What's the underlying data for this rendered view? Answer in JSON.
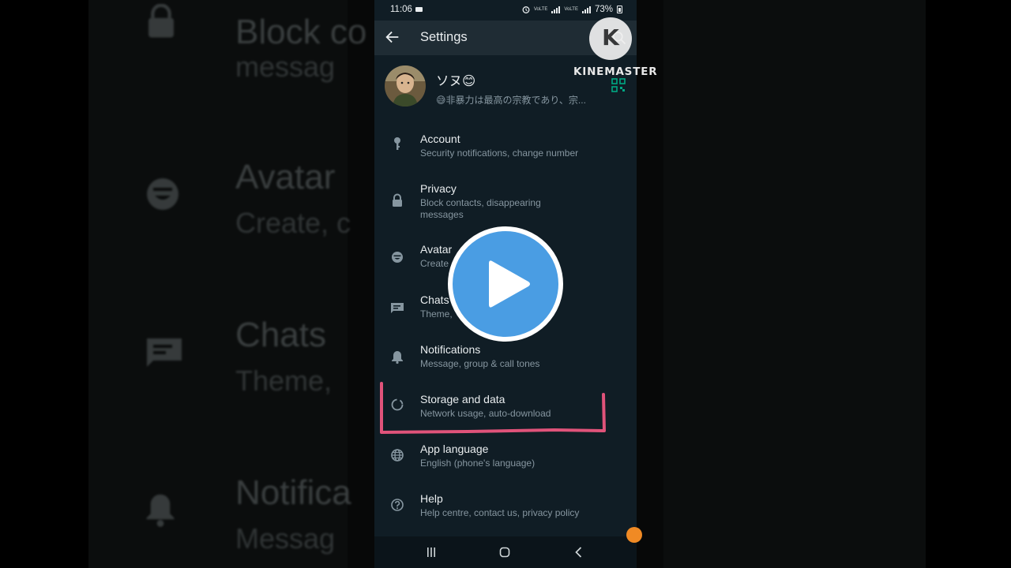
{
  "status_bar": {
    "time": "11:06",
    "battery": "73%",
    "sim_label": "VoLTE"
  },
  "app_bar": {
    "title": "Settings"
  },
  "profile": {
    "name": "ソヌ😊",
    "status": "😅非暴力は最高の宗教であり、宗..."
  },
  "menu_items": [
    {
      "title": "Account",
      "subtitle": "Security notifications, change number",
      "icon": "key-icon"
    },
    {
      "title": "Privacy",
      "subtitle": "Block contacts, disappearing messages",
      "icon": "lock-icon"
    },
    {
      "title": "Avatar",
      "subtitle": "Create",
      "icon": "avatar-icon"
    },
    {
      "title": "Chats",
      "subtitle": "Theme,",
      "icon": "chat-icon"
    },
    {
      "title": "Notifications",
      "subtitle": "Message, group & call tones",
      "icon": "bell-icon"
    },
    {
      "title": "Storage and data",
      "subtitle": "Network usage, auto-download",
      "icon": "storage-circle-icon"
    },
    {
      "title": "App language",
      "subtitle": "English (phone's language)",
      "icon": "globe-icon"
    },
    {
      "title": "Help",
      "subtitle": "Help centre, contact us, privacy policy",
      "icon": "help-icon"
    }
  ],
  "background": {
    "lines": [
      {
        "title": "Block co",
        "sub": "messag"
      },
      {
        "title": "Avatar",
        "sub": "Create, c"
      },
      {
        "title": "Chats",
        "sub": "Theme, "
      },
      {
        "title": "Notifica",
        "sub": "Messag"
      }
    ]
  },
  "overlay": {
    "watermark": "KINEMASTER",
    "watermark_logo_letter": "K"
  },
  "colors": {
    "app_background": "#101d25",
    "app_bar": "#1f2c34",
    "primary_text": "#e9edef",
    "secondary_text": "#8696a0",
    "highlight": "#e0537a",
    "play_button": "#4a9de3"
  }
}
